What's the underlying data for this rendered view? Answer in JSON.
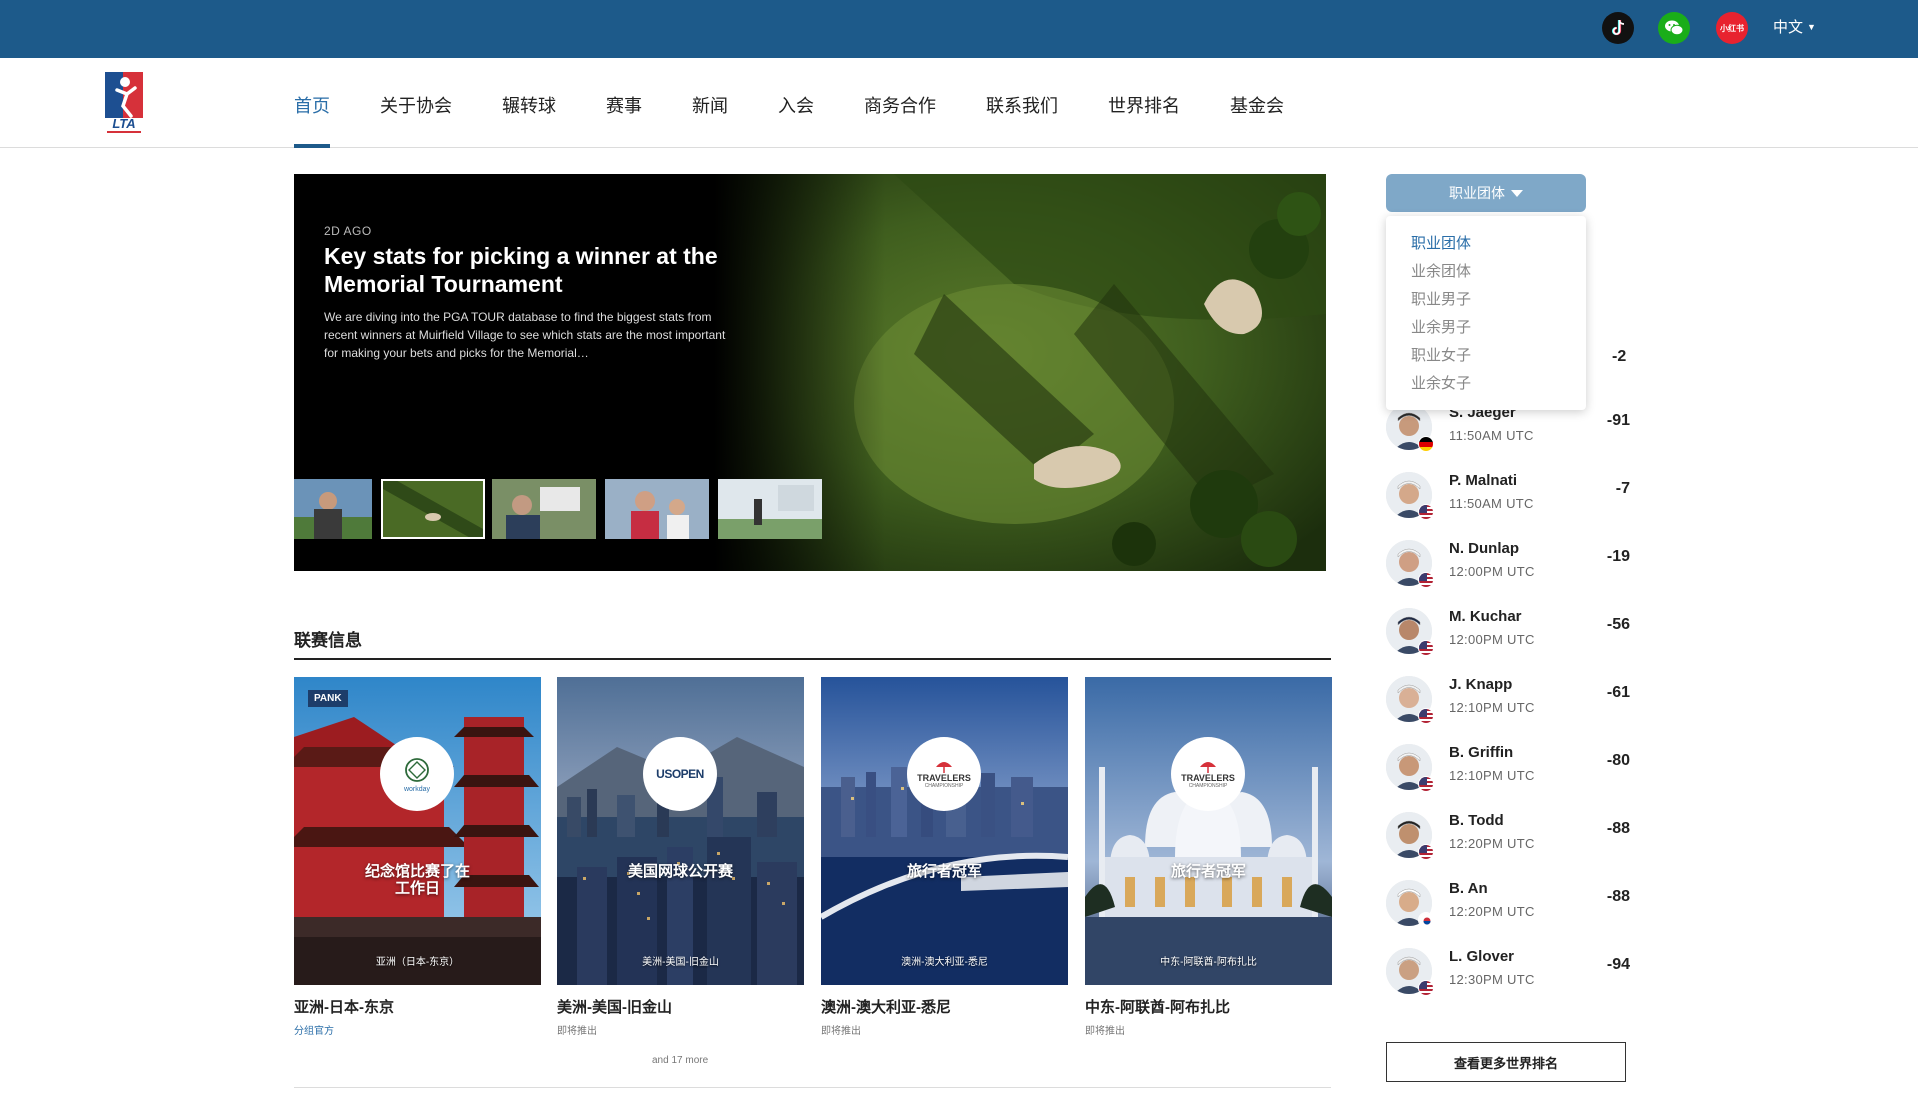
{
  "topbar": {
    "icons": [
      "tiktok-icon",
      "wechat-icon",
      "xiaohongshu-icon"
    ],
    "xhs_label": "小红书",
    "language": "中文"
  },
  "logo_text": "LTA",
  "nav": {
    "items": [
      {
        "label": "首页",
        "active": true
      },
      {
        "label": "关于协会"
      },
      {
        "label": "辗转球"
      },
      {
        "label": "赛事"
      },
      {
        "label": "新闻"
      },
      {
        "label": "入会"
      },
      {
        "label": "商务合作"
      },
      {
        "label": "联系我们"
      },
      {
        "label": "世界排名"
      },
      {
        "label": "基金会"
      }
    ]
  },
  "hero": {
    "time": "2D AGO",
    "title": "Key stats for picking a winner at the Memorial Tournament",
    "description": "We are diving into the PGA TOUR database to find the biggest stats from recent winners at Muirfield Village to see which stats are the most important for making your bets and picks for the Memorial…"
  },
  "league": {
    "title": "联赛信息",
    "cards": [
      {
        "badge": "PANK",
        "logo": "workday",
        "name": "纪念馆比赛了在工作日",
        "location": "亚洲（日本-东京）",
        "caption": "亚洲-日本-东京",
        "sub": "分组官方",
        "sub_link": true
      },
      {
        "logo": "USOPEN",
        "name": "美国网球公开赛",
        "location": "美洲-美国-旧金山",
        "caption": "美洲-美国-旧金山",
        "sub": "即将推出"
      },
      {
        "logo": "TRAVELERS",
        "logo_sub": "CHAMPIONSHIP",
        "name": "旅行者冠军",
        "location": "澳洲-澳大利亚-悉尼",
        "caption": "澳洲-澳大利亚-悉尼",
        "sub": "即将推出"
      },
      {
        "logo": "TRAVELERS",
        "logo_sub": "CHAMPIONSHIP",
        "name": "旅行者冠军",
        "location": "中东-阿联酋-阿布扎比",
        "caption": "中东-阿联酋-阿布扎比",
        "sub": "即将推出"
      }
    ],
    "more": "and 17 more"
  },
  "rankings": {
    "dropdown_label": "职业团体",
    "options": [
      "职业团体",
      "业余团体",
      "职业男子",
      "业余男子",
      "职业女子",
      "业余女子"
    ],
    "partial_score": "-2",
    "players": [
      {
        "name": "S. Jaeger",
        "time": "11:50AM UTC",
        "score": "-91",
        "flag": "de"
      },
      {
        "name": "P. Malnati",
        "time": "11:50AM UTC",
        "score": "-7",
        "flag": "us"
      },
      {
        "name": "N. Dunlap",
        "time": "12:00PM UTC",
        "score": "-19",
        "flag": "us"
      },
      {
        "name": "M. Kuchar",
        "time": "12:00PM UTC",
        "score": "-56",
        "flag": "us"
      },
      {
        "name": "J. Knapp",
        "time": "12:10PM UTC",
        "score": "-61",
        "flag": "us"
      },
      {
        "name": "B. Griffin",
        "time": "12:10PM UTC",
        "score": "-80",
        "flag": "us"
      },
      {
        "name": "B. Todd",
        "time": "12:20PM UTC",
        "score": "-88",
        "flag": "us"
      },
      {
        "name": "B. An",
        "time": "12:20PM UTC",
        "score": "-88",
        "flag": "kr"
      },
      {
        "name": "L. Glover",
        "time": "12:30PM UTC",
        "score": "-94",
        "flag": "us"
      }
    ],
    "more_button": "查看更多世界排名"
  },
  "colors": {
    "brand": "#1d5a8a",
    "link": "#2a6ea8",
    "dropdown": "#7fa8c8"
  }
}
